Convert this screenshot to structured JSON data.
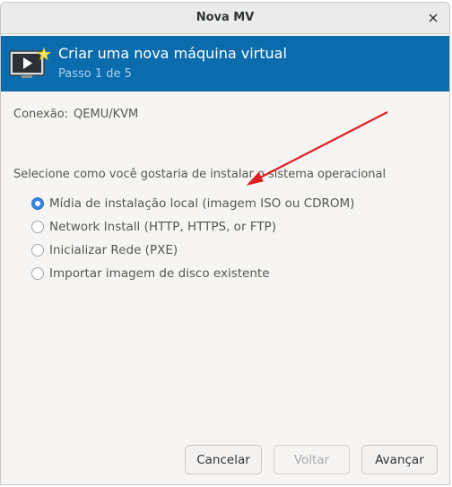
{
  "window": {
    "title": "Nova MV",
    "close_icon": "close-icon"
  },
  "banner": {
    "title": "Criar uma nova máquina virtual",
    "step": "Passo 1 de 5",
    "background": "#0b6cad",
    "icon": "new-vm-icon"
  },
  "connection": {
    "label": "Conexão:",
    "value": "QEMU/KVM"
  },
  "install": {
    "question": "Selecione como você gostaria de instalar o sistema operacional",
    "selected_index": 0,
    "options": [
      "Mídia de instalação local (imagem ISO ou CDROM)",
      "Network Install (HTTP, HTTPS, or FTP)",
      "Inicializar Rede (PXE)",
      "Importar imagem de disco existente"
    ]
  },
  "buttons": {
    "cancel": "Cancelar",
    "back": "Voltar",
    "forward": "Avançar"
  },
  "annotation": {
    "color": "#e02020"
  }
}
